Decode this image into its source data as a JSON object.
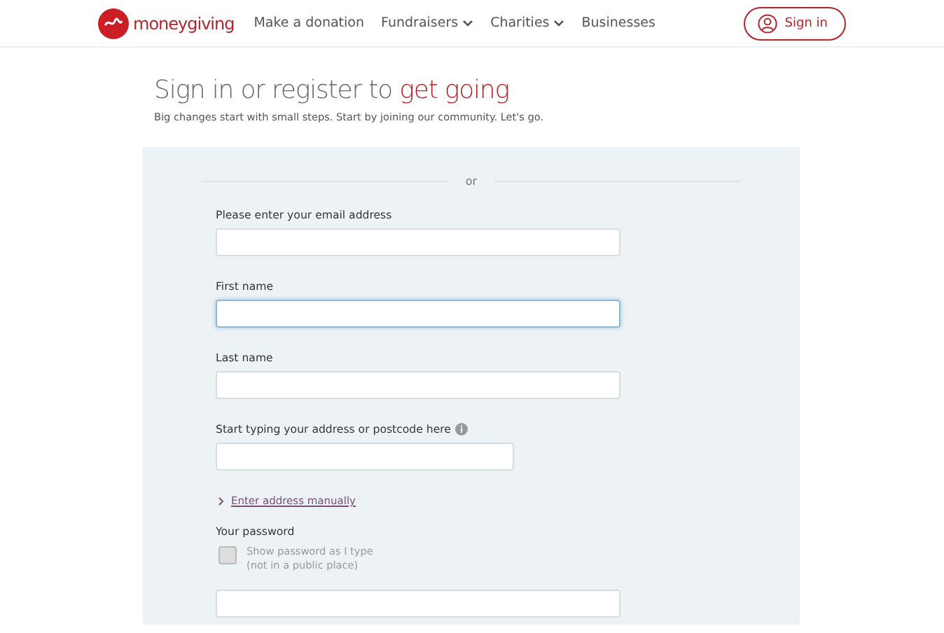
{
  "header": {
    "brand": "moneygiving",
    "nav": [
      {
        "label": "Make a donation",
        "dropdown": false
      },
      {
        "label": "Fundraisers",
        "dropdown": true
      },
      {
        "label": "Charities",
        "dropdown": true
      },
      {
        "label": "Businesses",
        "dropdown": false
      }
    ],
    "sign_in": "Sign in"
  },
  "heading": {
    "text": "Sign in or register to",
    "highlight": "get going",
    "subtitle": "Big changes start with small steps. Start by joining our community. Let's go."
  },
  "form": {
    "divider": "or",
    "items": [
      {
        "kind": "field",
        "label": "Please enter your email address",
        "focused": false,
        "short": false
      },
      {
        "kind": "field",
        "label": "First name",
        "focused": true,
        "short": false
      },
      {
        "kind": "field",
        "label": "Last name",
        "focused": false,
        "short": false
      },
      {
        "kind": "info_field",
        "label": "Start typing your address or postcode here",
        "focused": false,
        "short": true
      },
      {
        "kind": "link",
        "label": "Enter address manually"
      },
      {
        "kind": "label",
        "label": "Your password"
      },
      {
        "kind": "checkbox",
        "label": "Show password as I type",
        "note": "(not in a public place)",
        "checked": false
      },
      {
        "kind": "input",
        "focused": false
      }
    ]
  }
}
